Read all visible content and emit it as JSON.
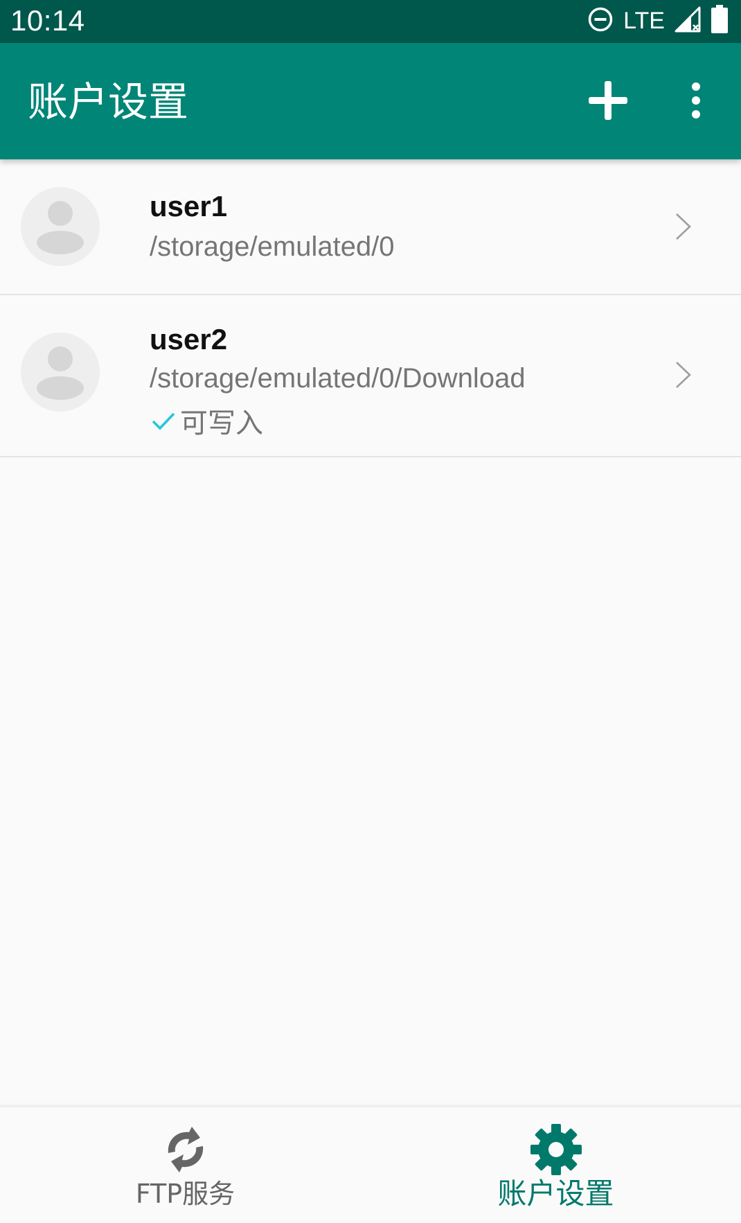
{
  "status_bar": {
    "time": "10:14",
    "network": "LTE",
    "icons": [
      "do-not-disturb-icon",
      "signal-icon",
      "battery-icon"
    ]
  },
  "app_bar": {
    "title": "账户设置",
    "actions": [
      "add-icon",
      "more-vert-icon"
    ]
  },
  "accounts": [
    {
      "name": "user1",
      "path": "/storage/emulated/0",
      "writable": false
    },
    {
      "name": "user2",
      "path": "/storage/emulated/0/Download",
      "writable": true,
      "writable_label": "可写入"
    }
  ],
  "bottom_nav": {
    "items": [
      {
        "label": "FTP服务",
        "icon": "sync-icon",
        "selected": false
      },
      {
        "label": "账户设置",
        "icon": "gear-icon",
        "selected": true
      }
    ]
  },
  "colors": {
    "status_bar": "#00574b",
    "app_bar": "#008577",
    "accent_selected": "#00796b",
    "check": "#26c6da",
    "background": "#fafafa"
  }
}
